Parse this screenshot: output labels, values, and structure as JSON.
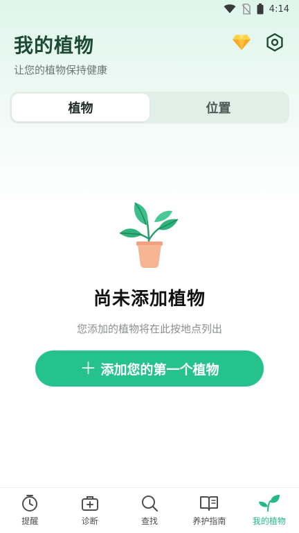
{
  "status_bar": {
    "time": "4:14"
  },
  "header": {
    "title": "我的植物",
    "subtitle": "让您的植物保持健康",
    "icons": [
      "diamond-icon",
      "settings-icon"
    ]
  },
  "tabs": [
    {
      "label": "植物",
      "active": true
    },
    {
      "label": "位置",
      "active": false
    }
  ],
  "empty_state": {
    "title": "尚未添加植物",
    "description": "您添加的植物将在此按地点列出",
    "cta_label": "添加您的第一个植物",
    "cta_icon": "plus-icon"
  },
  "bottom_nav": [
    {
      "label": "提醒",
      "icon": "clock-icon",
      "active": false
    },
    {
      "label": "诊断",
      "icon": "medical-kit-icon",
      "active": false
    },
    {
      "label": "查找",
      "icon": "search-icon",
      "active": false
    },
    {
      "label": "养护指南",
      "icon": "book-icon",
      "active": false
    },
    {
      "label": "我的植物",
      "icon": "leaf-icon",
      "active": true
    }
  ],
  "colors": {
    "accent": "#26c28d",
    "title": "#1c4a35",
    "nav_active": "#26b884"
  }
}
